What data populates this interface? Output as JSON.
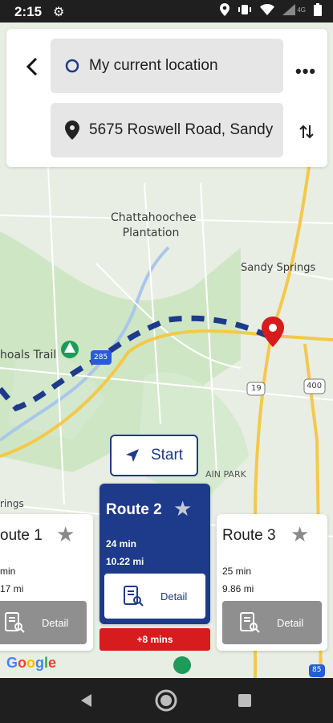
{
  "status_bar": {
    "time": "2:15",
    "network": "4G"
  },
  "search": {
    "origin": "My current location",
    "destination": "5675 Roswell Road, Sandy"
  },
  "map": {
    "labels": {
      "plantation": "Chattahoochee\nPlantation",
      "sandy_springs": "Sandy Springs",
      "trail": "hoals Trail",
      "park": "AIN PARK",
      "springs": "rings",
      "hw_285": "285",
      "hw_19": "19",
      "hw_400": "400",
      "hw_85": "85"
    },
    "attribution": "Google"
  },
  "start_button": {
    "label": "Start"
  },
  "routes": [
    {
      "name": "oute 1",
      "time": "min",
      "distance": "17 mi",
      "detail_label": "Detail"
    },
    {
      "name": "Route 2",
      "time": "24 min",
      "distance": "10.22 mi",
      "detail_label": "Detail",
      "extra": "+8 mins"
    },
    {
      "name": "Route 3",
      "time": "25 min",
      "distance": "9.86 mi",
      "detail_label": "Detail"
    }
  ],
  "colors": {
    "primary": "#1e3a8a",
    "alert": "#d61c1c",
    "route_dash": "#f5c542"
  }
}
